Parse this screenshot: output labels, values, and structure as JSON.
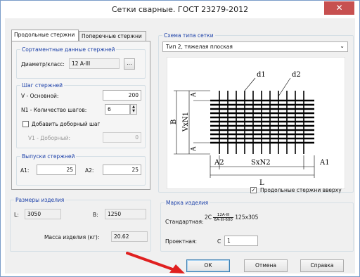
{
  "window": {
    "title": "Сетки сварные. ГОСТ 23279-2012",
    "close_glyph": "✕"
  },
  "tabs": [
    {
      "label": "Продольные стержни",
      "active": true
    },
    {
      "label": "Поперечные стержни",
      "active": false
    }
  ],
  "assortment": {
    "title": "Сортаментные данные стержней",
    "diameter_label": "Диаметр/класс:",
    "diameter_value": "12 A-III",
    "browse_label": "..."
  },
  "step": {
    "title": "Шаг стержней",
    "v_label": "V - Основной:",
    "v_value": "200",
    "n_label": "N1 - Количество шагов:",
    "n_value": "6",
    "extra_label": "Добавить доборный шаг",
    "v1_label": "V1 - Доборный:",
    "v1_value": "0"
  },
  "outlets": {
    "title": "Выпуски стержней",
    "a1_label": "A1:",
    "a1_value": "25",
    "a2_label": "A2:",
    "a2_value": "25"
  },
  "sizes": {
    "title": "Размеры изделия",
    "l_label": "L:",
    "l_value": "3050",
    "b_label": "B:",
    "b_value": "1250",
    "mass_label": "Масса изделия (кг):",
    "mass_value": "20.62"
  },
  "scheme": {
    "title": "Схема типа сетки",
    "selected": "Тип 2, тяжелая плоская",
    "labels": {
      "d1": "d1",
      "d2": "d2",
      "a": "A",
      "b": "B",
      "vxn1": "VxN1",
      "a1": "A1",
      "a2": "A2",
      "sxn2": "SxN2",
      "l": "L"
    }
  },
  "top_bars_label": "Продольные стержни вверху",
  "mark": {
    "title": "Марка изделия",
    "standard_label": "Стандартная:",
    "std_prefix": "2С",
    "std_num": "12A-III",
    "std_den": "6A-III-600",
    "std_suffix": "125х305",
    "project_label": "Проектная:",
    "project_prefix": "С",
    "project_value": "1"
  },
  "buttons": {
    "ok": "ОК",
    "cancel": "Отмена",
    "help": "Справка"
  },
  "colors": {
    "accent": "#1a3fa8",
    "arrow": "#e02020",
    "close": "#c75050"
  }
}
